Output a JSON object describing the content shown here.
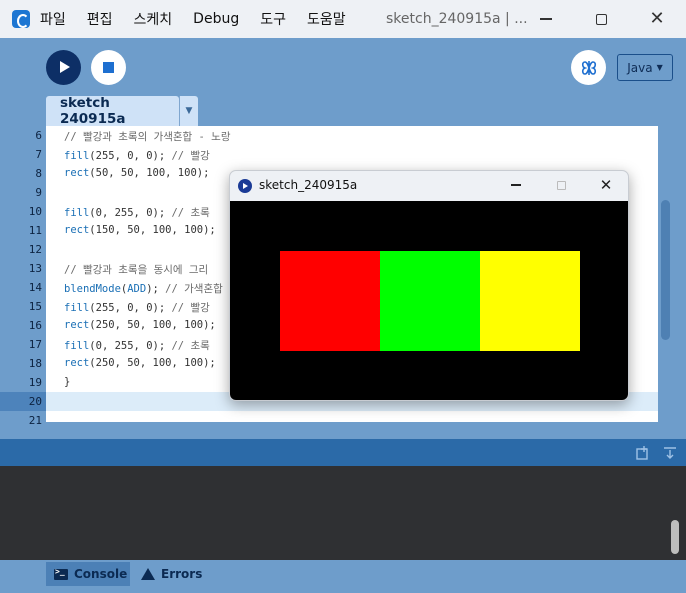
{
  "menu": [
    "파일",
    "편집",
    "스케치",
    "Debug",
    "도구",
    "도움말"
  ],
  "window_title": "sketch_240915a | ...",
  "toolbar": {
    "mode_label": "Java",
    "mode_arrow": "▼"
  },
  "tab": {
    "label": "sketch 240915a",
    "arrow": "▼"
  },
  "editor": {
    "lines": [
      {
        "n": "6",
        "text": "// 빨강과 초록의 가색혼합 - 노랑"
      },
      {
        "n": "7",
        "text": "fill(255, 0, 0); // 빨강"
      },
      {
        "n": "8",
        "text": "rect(50, 50, 100, 100);"
      },
      {
        "n": "9",
        "text": ""
      },
      {
        "n": "10",
        "text": "fill(0, 255, 0); // 초록"
      },
      {
        "n": "11",
        "text": "rect(150, 50, 100, 100);"
      },
      {
        "n": "12",
        "text": ""
      },
      {
        "n": "13",
        "text": "// 빨강과 초록을 동시에 그리"
      },
      {
        "n": "14",
        "text": "blendMode(ADD); // 가색혼합"
      },
      {
        "n": "15",
        "text": "fill(255, 0, 0); // 빨강"
      },
      {
        "n": "16",
        "text": "rect(250, 50, 100, 100);"
      },
      {
        "n": "17",
        "text": "fill(0, 255, 0); // 초록"
      },
      {
        "n": "18",
        "text": "rect(250, 50, 100, 100);"
      },
      {
        "n": "19",
        "text": "}"
      },
      {
        "n": "20",
        "text": ""
      },
      {
        "n": "21",
        "text": ""
      }
    ]
  },
  "sketch_window": {
    "title": "sketch_240915a",
    "close": "✕",
    "rects": [
      {
        "color": "#ff0000"
      },
      {
        "color": "#00ff00"
      },
      {
        "color": "#ffff00"
      }
    ]
  },
  "console": {
    "tab_label": "Console",
    "errors_label": "Errors"
  },
  "colors": {
    "accent": "#1e6fd0",
    "frame": "#6e9dcb",
    "console_bg": "#2f3033"
  },
  "window_controls": {
    "close": "✕"
  }
}
